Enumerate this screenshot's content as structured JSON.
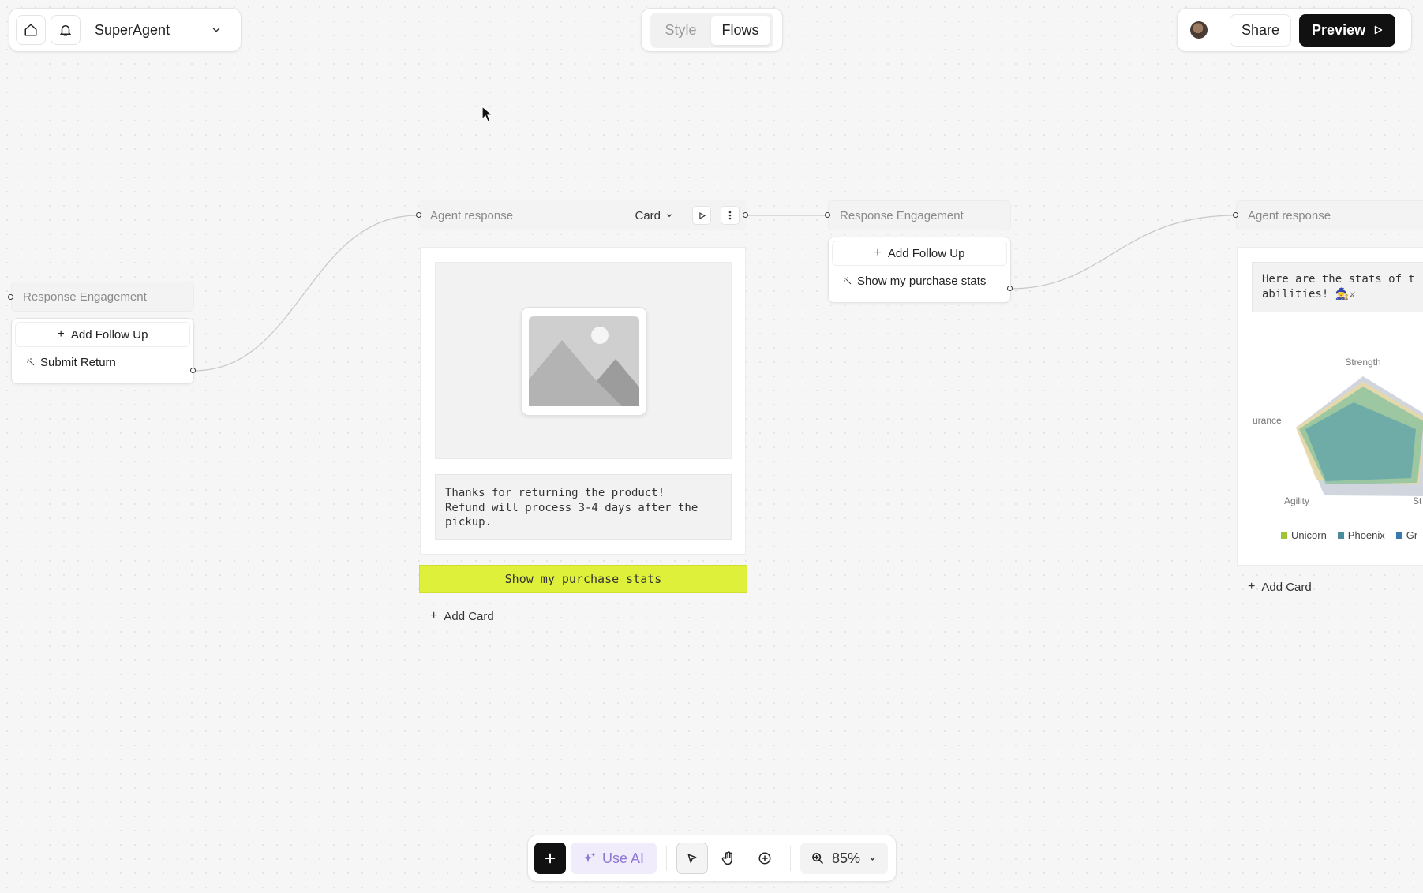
{
  "topbar": {
    "project_name": "SuperAgent",
    "tabs": [
      {
        "label": "Style",
        "active": false
      },
      {
        "label": "Flows",
        "active": true
      }
    ],
    "share_label": "Share",
    "preview_label": "Preview"
  },
  "nodes": {
    "left_engagement": {
      "header": "Response Engagement",
      "follow_up_label": "Add Follow Up",
      "item_label": "Submit Return"
    },
    "agent_response_1": {
      "header": "Agent response",
      "type_select": "Card",
      "message": "Thanks for returning the product!\nRefund will process 3-4 days after the pickup.",
      "cta_label": "Show my purchase stats",
      "add_card_label": "Add Card"
    },
    "middle_engagement": {
      "header": "Response Engagement",
      "follow_up_label": "Add Follow Up",
      "item_label": "Show my purchase stats"
    },
    "agent_response_2": {
      "header": "Agent response",
      "message": "Here are the stats of t\nabilities! 🧙⚔",
      "add_card_label": "Add Card"
    }
  },
  "chart_data": {
    "type": "radar",
    "axis_labels": [
      "Strength",
      "urance",
      "Agility",
      "St"
    ],
    "legend": [
      {
        "name": "Unicorn",
        "color": "#9ec53a"
      },
      {
        "name": "Phoenix",
        "color": "#4a8c9a"
      },
      {
        "name": "Gr",
        "color": "#3c78b0"
      }
    ]
  },
  "toolbar": {
    "use_ai_label": "Use AI",
    "zoom_label": "85%"
  }
}
